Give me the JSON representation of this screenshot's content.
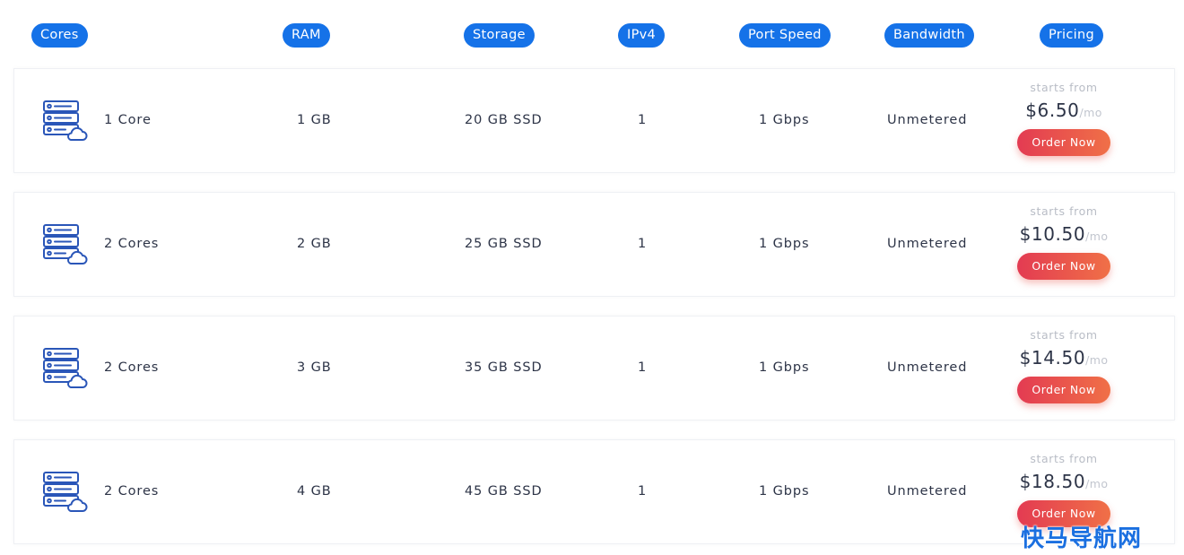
{
  "header": {
    "cores": "Cores",
    "ram": "RAM",
    "storage": "Storage",
    "ipv4": "IPv4",
    "port_speed": "Port Speed",
    "bandwidth": "Bandwidth",
    "pricing": "Pricing"
  },
  "colors": {
    "header_pill": "#1572e8",
    "order_button_start": "#e33b52",
    "order_button_end": "#f07047",
    "text": "#2d3447",
    "icon": "#2a56b8"
  },
  "plans": [
    {
      "icon": "server-cloud-icon",
      "cores": "1 Core",
      "ram": "1 GB",
      "storage": "20 GB SSD",
      "ipv4": "1",
      "port_speed": "1 Gbps",
      "bandwidth": "Unmetered",
      "starts_from": "starts from",
      "price": "$6.50",
      "per": "/mo",
      "order_label": "Order Now"
    },
    {
      "icon": "server-cloud-icon",
      "cores": "2 Cores",
      "ram": "2 GB",
      "storage": "25 GB SSD",
      "ipv4": "1",
      "port_speed": "1 Gbps",
      "bandwidth": "Unmetered",
      "starts_from": "starts from",
      "price": "$10.50",
      "per": "/mo",
      "order_label": "Order Now"
    },
    {
      "icon": "server-cloud-icon",
      "cores": "2 Cores",
      "ram": "3 GB",
      "storage": "35 GB SSD",
      "ipv4": "1",
      "port_speed": "1 Gbps",
      "bandwidth": "Unmetered",
      "starts_from": "starts from",
      "price": "$14.50",
      "per": "/mo",
      "order_label": "Order Now"
    },
    {
      "icon": "server-cloud-icon",
      "cores": "2 Cores",
      "ram": "4 GB",
      "storage": "45 GB SSD",
      "ipv4": "1",
      "port_speed": "1 Gbps",
      "bandwidth": "Unmetered",
      "starts_from": "starts from",
      "price": "$18.50",
      "per": "/mo",
      "order_label": "Order Now"
    }
  ],
  "watermark": "快马导航网"
}
